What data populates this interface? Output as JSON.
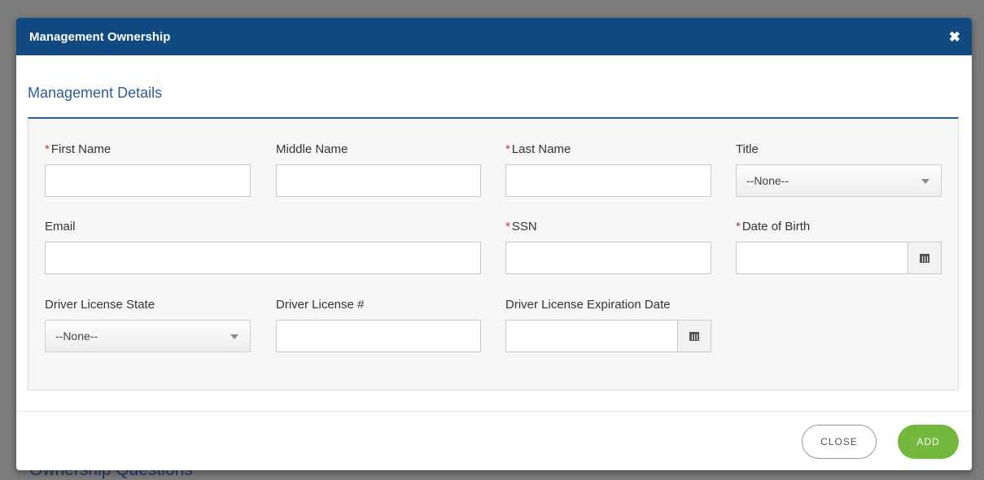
{
  "background": {
    "peek_text": "Ownership Questions"
  },
  "modal": {
    "title": "Management Ownership",
    "close_symbol": "✖"
  },
  "section": {
    "title": "Management Details"
  },
  "required_marker": "*",
  "fields": {
    "first_name": {
      "label": "First Name",
      "required": true,
      "value": ""
    },
    "middle_name": {
      "label": "Middle Name",
      "required": false,
      "value": ""
    },
    "last_name": {
      "label": "Last Name",
      "required": true,
      "value": ""
    },
    "title": {
      "label": "Title",
      "selected": "--None--"
    },
    "email": {
      "label": "Email",
      "value": ""
    },
    "ssn": {
      "label": "SSN",
      "required": true,
      "value": ""
    },
    "dob": {
      "label": "Date of Birth",
      "required": true,
      "value": ""
    },
    "dl_state": {
      "label": "Driver License State",
      "selected": "--None--"
    },
    "dl_number": {
      "label": "Driver License #",
      "value": ""
    },
    "dl_expiration": {
      "label": "Driver License Expiration Date",
      "value": ""
    }
  },
  "buttons": {
    "close": "CLOSE",
    "add": "ADD"
  },
  "colors": {
    "header": "#104a80",
    "section_title": "#2a5d9a",
    "required": "#c23934",
    "add_button": "#74b83e"
  }
}
